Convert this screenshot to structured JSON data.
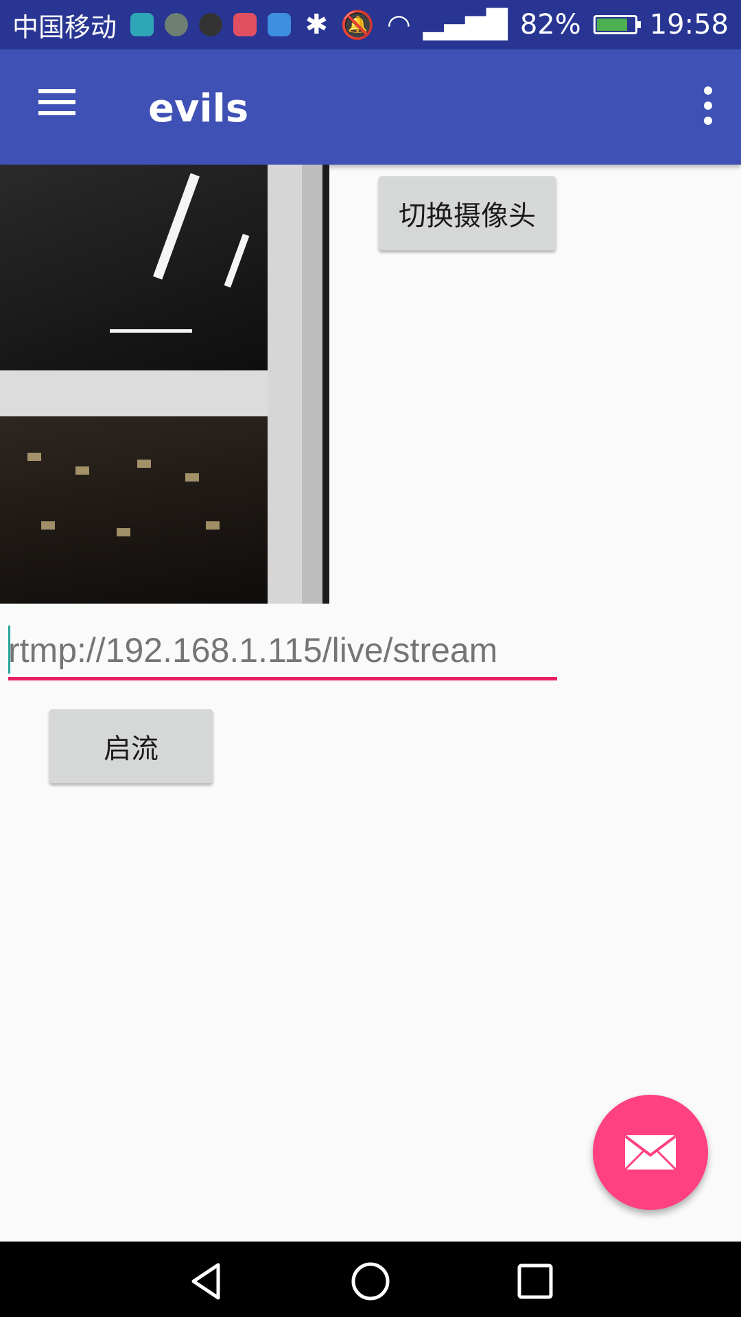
{
  "status_bar": {
    "carrier": "中国移动",
    "battery_percent": "82%",
    "battery_level": 0.82,
    "time": "19:58",
    "notification_icons": [
      "android-icon",
      "music-icon",
      "rocket-icon",
      "tool-icon",
      "cloud-icon"
    ],
    "system_icons": [
      "bluetooth-icon",
      "mute-icon",
      "wifi-icon",
      "signal-icon",
      "battery-icon"
    ]
  },
  "app_bar": {
    "title": "evils",
    "menu_icon": "menu-icon",
    "overflow_icon": "more-vertical-icon"
  },
  "camera": {
    "switch_label": "切换摄像头"
  },
  "stream": {
    "url_placeholder": "rtmp://192.168.1.115/live/stream",
    "start_label": "启流"
  },
  "fab": {
    "icon": "mail-icon",
    "color": "#ff4081"
  },
  "colors": {
    "status_bar": "#283593",
    "app_bar": "#3f51b5",
    "accent": "#e91e63"
  },
  "nav_bar": {
    "buttons": [
      "back-icon",
      "home-icon",
      "recent-apps-icon"
    ]
  }
}
